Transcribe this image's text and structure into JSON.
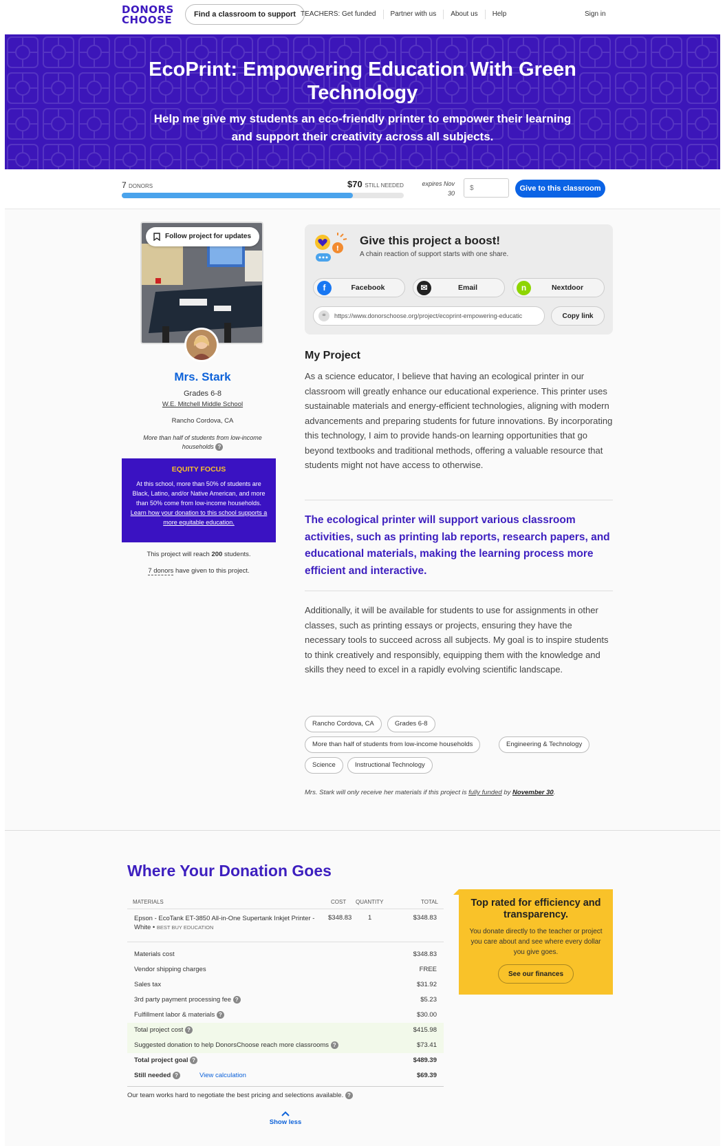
{
  "nav": {
    "logo_line1": "DONORS",
    "logo_line2": "CHOOSE",
    "find_classroom": "Find a classroom to support",
    "links": [
      "TEACHERS: Get funded",
      "Partner with us",
      "About us",
      "Help"
    ],
    "sign_in": "Sign in"
  },
  "hero": {
    "title": "EcoPrint: Empowering Education With Green Technology",
    "subtitle": "Help me give my students an eco-friendly printer to empower their learning and support their creativity across all subjects."
  },
  "progress": {
    "donors_count": "7",
    "donors_label": "DONORS",
    "still_needed_amount": "$70",
    "still_needed_label": "STILL NEEDED",
    "expires": "expires Nov 30",
    "percent_funded": 0.82,
    "amount_placeholder": "$",
    "give_button": "Give to this classroom"
  },
  "teacher": {
    "follow": "Follow project for updates",
    "name": "Mrs. Stark",
    "grades": "Grades 6-8",
    "school": "W.E. Mitchell Middle School",
    "location": "Rancho Cordova, CA",
    "poverty": "More than half of students from low-income households"
  },
  "equity": {
    "heading": "EQUITY FOCUS",
    "text": "At this school, more than 50% of students are Black, Latino, and/or Native American, and more than 50% come from low-income households.",
    "link": "Learn how your donation to this school supports a more equitable education."
  },
  "reach": {
    "prefix": "This project will reach",
    "count": "200",
    "suffix": "students."
  },
  "donors_given": {
    "link": "7 donors",
    "suffix": "have given to this project."
  },
  "boost": {
    "title": "Give this project a boost!",
    "subtitle": "A chain reaction of support starts with one share.",
    "facebook": "Facebook",
    "email": "Email",
    "nextdoor": "Nextdoor",
    "url": "https://www.donorschoose.org/project/ecoprint-empowering-educatic",
    "copy": "Copy link"
  },
  "project": {
    "heading": "My Project",
    "para1": "As a science educator, I believe that having an ecological printer in our classroom will greatly enhance our educational experience. This printer uses sustainable materials and energy-efficient technologies, aligning with modern advancements and preparing students for future innovations. By incorporating this technology, I aim to provide hands-on learning opportunities that go beyond textbooks and traditional methods, offering a valuable resource that students might not have access to otherwise.",
    "quote": "The ecological printer will support various classroom activities, such as printing lab reports, research papers, and educational materials, making the learning process more efficient and interactive.",
    "para2": "Additionally, it will be available for students to use for assignments in other classes, such as printing essays or projects, ensuring they have the necessary tools to succeed across all subjects. My goal is to inspire students to think creatively and responsibly, equipping them with the knowledge and skills they need to excel in a rapidly evolving scientific landscape.",
    "tags": [
      "Rancho Cordova, CA",
      "Grades 6-8",
      "More than half of students from low-income households",
      "Engineering & Technology",
      "Science",
      "Instructional Technology"
    ],
    "funded_prefix": "Mrs. Stark will only receive her materials if this project is",
    "funded_link": "fully funded",
    "funded_by": "by",
    "funded_date": "November 30",
    "funded_end": "."
  },
  "donation": {
    "title": "Where Your Donation Goes",
    "headers": {
      "materials": "MATERIALS",
      "cost": "COST",
      "quantity": "QUANTITY",
      "total": "TOTAL"
    },
    "item": {
      "name": "Epson - EcoTank ET-3850 All-in-One Supertank Inkjet Printer - White",
      "vendor": "BEST BUY EDUCATION",
      "cost": "$348.83",
      "quantity": "1",
      "total": "$348.83"
    },
    "fees": [
      {
        "label": "Materials cost",
        "value": "$348.83"
      },
      {
        "label": "Vendor shipping charges",
        "value": "FREE"
      },
      {
        "label": "Sales tax",
        "value": "$31.92"
      },
      {
        "label": "3rd party payment processing fee",
        "value": "$5.23"
      },
      {
        "label": "Fulfillment labor & materials",
        "value": "$30.00"
      },
      {
        "label": "Total project cost",
        "value": "$415.98"
      },
      {
        "label": "Suggested donation to help DonorsChoose reach more classrooms",
        "value": "$73.41"
      },
      {
        "label": "Total project goal",
        "value": "$489.39"
      },
      {
        "label": "Still needed",
        "value": "$69.39"
      }
    ],
    "view_calc": "View calculation",
    "team_note": "Our team works hard to negotiate the best pricing and selections available.",
    "show_less": "Show less"
  },
  "rated": {
    "title": "Top rated for efficiency and transparency.",
    "text": "You donate directly to the teacher or project you care about and see where every dollar you give goes.",
    "button": "See our finances"
  },
  "colors": {
    "brand_purple": "#3c16b9",
    "accent_blue": "#0b63e5",
    "progress_blue": "#4aa3ec",
    "equity_yellow": "#f9c229"
  }
}
